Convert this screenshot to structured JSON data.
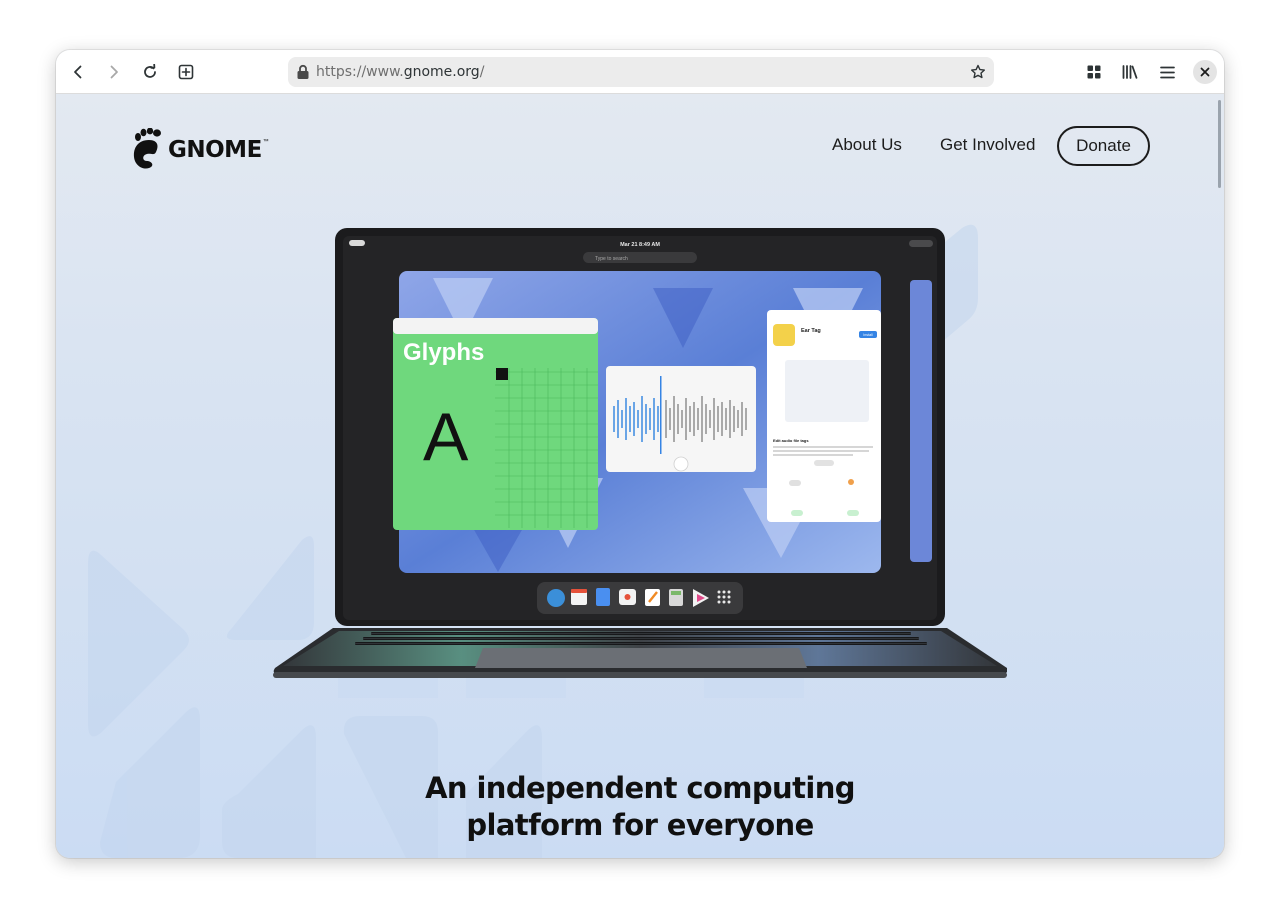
{
  "browser": {
    "url_host": "https://www.",
    "url_domain": "gnome.org",
    "url_path": "/",
    "icons": [
      "back-icon",
      "forward-icon",
      "reload-icon",
      "new-tab-icon",
      "lock-icon",
      "bookmark-star-icon",
      "grid-icon",
      "library-icon",
      "menu-icon",
      "close-icon"
    ]
  },
  "site": {
    "logo_text": "GNOME",
    "logo_tm": "™",
    "nav": {
      "about": "About Us",
      "involved": "Get Involved",
      "donate": "Donate"
    },
    "hero": {
      "line1": "An independent computing",
      "line2": "platform for everyone"
    }
  },
  "screen": {
    "clock": "Mar 21   8:49 AM",
    "search_placeholder": "Type to search",
    "glyphs_title": "Glyphs",
    "glyph_char": "A",
    "app_title": "Ear Tag",
    "app_button": "Install",
    "app_desc_heading": "Edit audio file tags"
  },
  "colors": {
    "accent": "#3584e4",
    "glyphs_green": "#6fd87d",
    "page_bg": "#d8e3f2"
  }
}
